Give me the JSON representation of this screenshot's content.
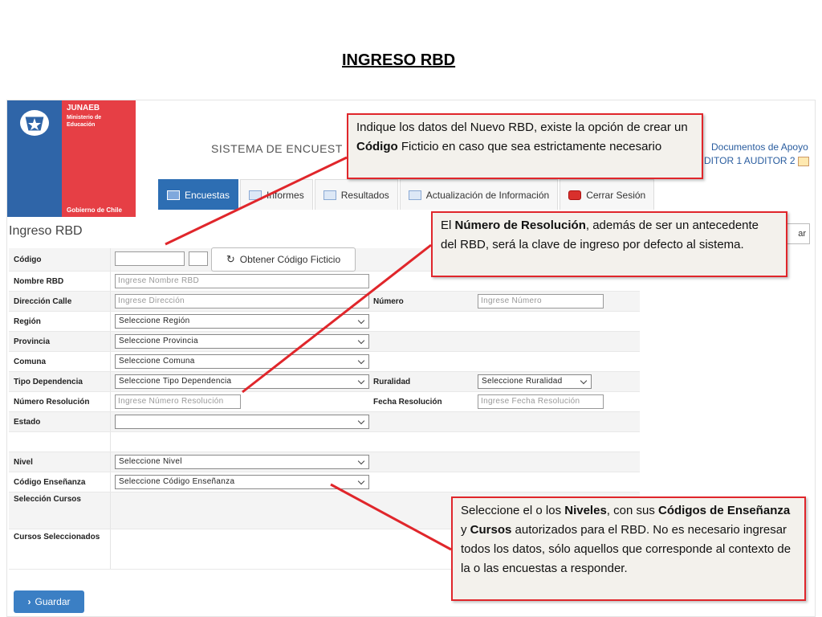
{
  "slide_title": "INGRESO RBD",
  "logo": {
    "org": "JUNAEB",
    "ministry": "Ministerio de Educación",
    "government": "Gobierno de Chile"
  },
  "header": {
    "system_title": "SISTEMA DE ENCUEST",
    "docs_link": "Documentos de Apoyo",
    "user": "DITOR 1 AUDITOR 2"
  },
  "tabs": [
    {
      "label": "Encuestas",
      "icon": "survey-icon"
    },
    {
      "label": "Informes",
      "icon": "report-icon"
    },
    {
      "label": "Resultados",
      "icon": "results-icon"
    },
    {
      "label": "Actualización de Información",
      "icon": "update-icon"
    },
    {
      "label": "Cerrar Sesión",
      "icon": "power-icon"
    }
  ],
  "page_title": "Ingreso RBD",
  "right_button": "ar",
  "form": {
    "codigo": {
      "label": "Código",
      "button": "Obtener Código Ficticio"
    },
    "nombre": {
      "label": "Nombre RBD",
      "placeholder": "Ingrese Nombre RBD"
    },
    "direccion": {
      "label": "Dirección Calle",
      "placeholder": "Ingrese Dirección"
    },
    "numero": {
      "label": "Número",
      "placeholder": "Ingrese Número"
    },
    "region": {
      "label": "Región",
      "value": "Seleccione Región"
    },
    "provincia": {
      "label": "Provincia",
      "value": "Seleccione Provincia"
    },
    "comuna": {
      "label": "Comuna",
      "value": "Seleccione Comuna"
    },
    "tipo_dependencia": {
      "label": "Tipo Dependencia",
      "value": "Seleccione Tipo Dependencia"
    },
    "ruralidad": {
      "label": "Ruralidad",
      "value": "Seleccione Ruralidad"
    },
    "numero_resolucion": {
      "label": "Número Resolución",
      "placeholder": "Ingrese Número Resolución"
    },
    "fecha_resolucion": {
      "label": "Fecha Resolución",
      "placeholder": "Ingrese Fecha Resolución"
    },
    "estado": {
      "label": "Estado",
      "value": ""
    },
    "nivel": {
      "label": "Nivel",
      "value": "Seleccione Nivel"
    },
    "codigo_ensenanza": {
      "label": "Código Enseñanza",
      "value": "Seleccione Código Enseñanza"
    },
    "seleccion_cursos": {
      "label": "Selección Cursos"
    },
    "cursos_seleccionados": {
      "label": "Cursos Seleccionados"
    }
  },
  "save_button": "Guardar",
  "callouts": {
    "c1": {
      "p1": "Indique los datos del Nuevo RBD, existe la opción de crear un ",
      "b1": "Código",
      "p2": " Ficticio en caso que sea estrictamente necesario"
    },
    "c2": {
      "p1": "El ",
      "b1": "Número de Resolución",
      "p2": ", además de ser un antecedente del RBD, será la clave de ingreso por defecto al sistema."
    },
    "c3": {
      "p1": "Seleccione el o los ",
      "b1": "Niveles",
      "p2": ", con sus ",
      "b2": "Códigos de Enseñanza",
      "p3": " y ",
      "b3": "Cursos",
      "p4": " autorizados para el RBD. No es necesario ingresar todos los datos, sólo aquellos que corresponde al contexto de la o las encuestas  a responder."
    }
  },
  "colors": {
    "accent": "#2d6eb3",
    "callout_border": "#e0262b",
    "logo_red": "#e63f45",
    "logo_blue": "#2f65a8"
  }
}
